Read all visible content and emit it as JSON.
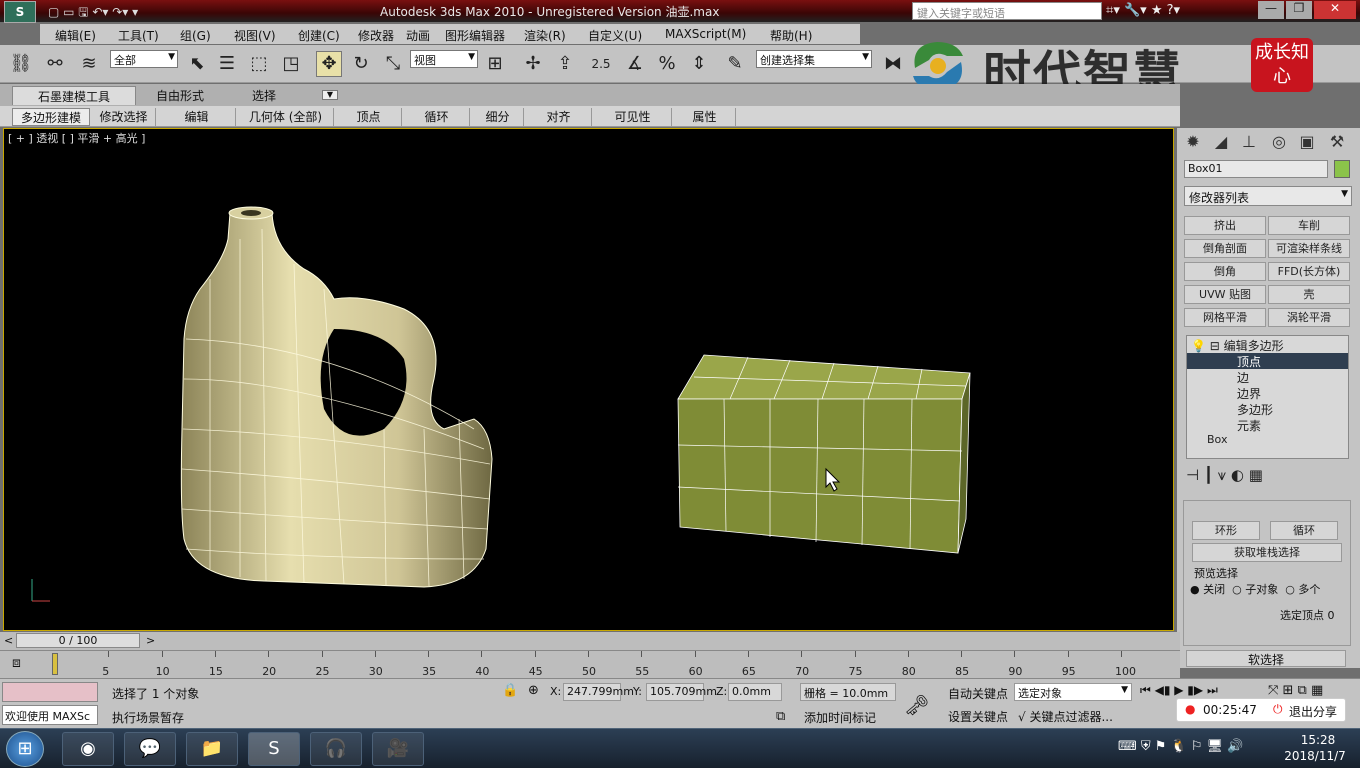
{
  "window": {
    "title": "Autodesk 3ds Max  2010   - Unregistered Version        油壶.max",
    "help_placeholder": "键入关键字或短语",
    "controls": [
      "—",
      "❐",
      "✕"
    ]
  },
  "menu": [
    "编辑(E)",
    "工具(T)",
    "组(G)",
    "视图(V)",
    "创建(C)",
    "修改器",
    "动画",
    "图形编辑器",
    "渲染(R)",
    "自定义(U)",
    "MAXScript(M)",
    "帮助(H)"
  ],
  "toolbar": {
    "filter_value": "全部",
    "coord_value": "视图",
    "snap_label": "2.5",
    "named_selection": "创建选择集"
  },
  "watermark": {
    "text": "时代智慧",
    "seal": "成长知心"
  },
  "ribbon_tabs": [
    "石墨建模工具",
    "自由形式",
    "选择"
  ],
  "ribbon_panels": [
    "多边形建模",
    "修改选择",
    "编辑",
    "几何体 (全部)",
    "顶点",
    "循环",
    "细分",
    "对齐",
    "可见性",
    "属性"
  ],
  "viewport": {
    "label": "[ + ] 透视 [ ] 平滑 + 高光 ]"
  },
  "command_panel": {
    "object_name": "Box01",
    "object_color": "#8bc34a",
    "modifier_list": "修改器列表",
    "modifier_buttons": [
      "挤出",
      "车削",
      "倒角剖面",
      "可渲染样条线",
      "倒角",
      "FFD(长方体)",
      "UVW 贴图",
      "壳",
      "网格平滑",
      "涡轮平滑"
    ],
    "stack": {
      "root": "编辑多边形",
      "items": [
        "顶点",
        "边",
        "边界",
        "多边形",
        "元素"
      ],
      "base": "Box"
    },
    "ring_label": "环形",
    "loop_label": "循环",
    "get_stack_sel": "获取堆栈选择",
    "preview": {
      "label": "预览选择",
      "options": [
        "关闭",
        "子对象",
        "多个"
      ]
    },
    "selected_vertices": "选定顶点 0",
    "soft_selection": "软选择"
  },
  "timeline": {
    "frame": "0 / 100",
    "ticks": [
      "5",
      "10",
      "15",
      "20",
      "25",
      "30",
      "35",
      "40",
      "45",
      "50",
      "55",
      "60",
      "65",
      "70",
      "75",
      "80",
      "85",
      "90",
      "95",
      "100"
    ]
  },
  "status": {
    "welcome": "欢迎使用 MAXSc",
    "selection": "选择了 1 个对象",
    "prompt": "执行场景暂存",
    "x": "247.799mm",
    "y": "105.709mm",
    "z": "0.0mm",
    "grid": "栅格 = 10.0mm",
    "add_time_tag": "添加时间标记",
    "auto_key": "自动关键点",
    "set_key": "设置关键点",
    "key_mode": "选定对象",
    "key_filter": "关键点过滤器..."
  },
  "recording": {
    "time": "00:25:47",
    "exit": "退出分享"
  },
  "taskbar": {
    "time": "15:28",
    "date": "2018/11/7"
  }
}
